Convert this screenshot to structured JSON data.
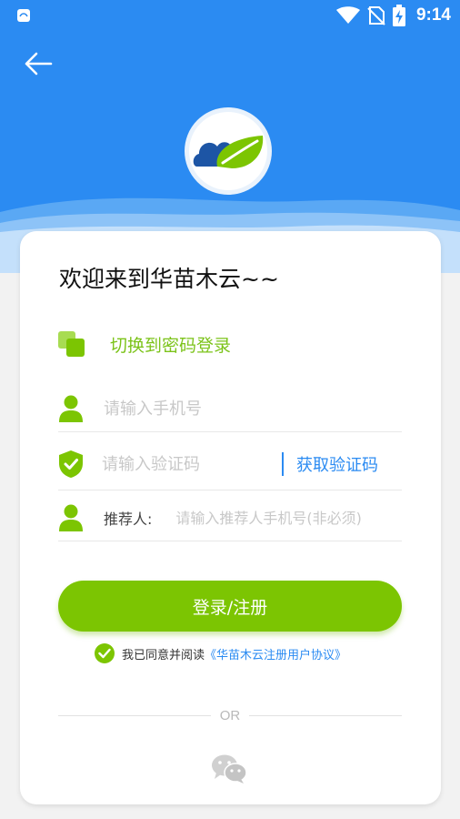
{
  "status_bar": {
    "time": "9:14"
  },
  "welcome_title": "欢迎来到华苗木云~~",
  "switch_login_label": "切换到密码登录",
  "phone_field": {
    "placeholder": "请输入手机号",
    "value": ""
  },
  "code_field": {
    "placeholder": "请输入验证码",
    "value": "",
    "get_code_label": "获取验证码"
  },
  "referrer_field": {
    "label": "推荐人:",
    "placeholder": "请输入推荐人手机号(非必须)",
    "value": ""
  },
  "login_button_label": "登录/注册",
  "agreement": {
    "prefix": "我已同意并阅读",
    "link_text": "《华苗木云注册用户协议》"
  },
  "divider_text": "OR",
  "colors": {
    "primary_blue": "#2b8bf2",
    "accent_green": "#7cc502"
  },
  "icons": [
    "app-notification-icon",
    "wifi-icon",
    "no-sim-icon",
    "battery-charging-icon",
    "back-arrow-icon",
    "cloud-leaf-logo-icon",
    "switch-squares-icon",
    "user-icon",
    "shield-check-icon",
    "check-icon",
    "wechat-icon"
  ]
}
